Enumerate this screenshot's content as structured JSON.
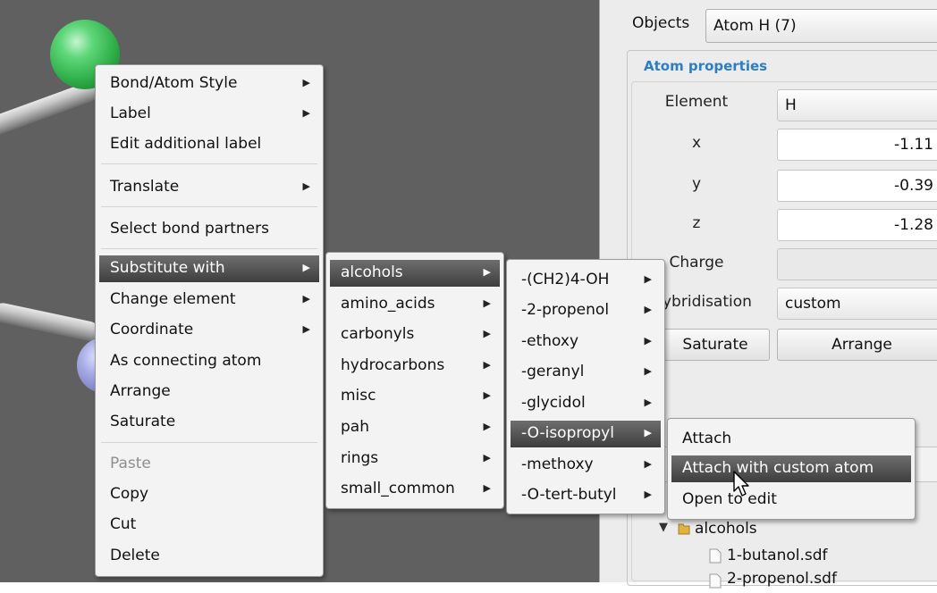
{
  "panel": {
    "objects_label": "Objects",
    "objects_value": "Atom H (7)",
    "section_title": "Atom properties",
    "element_label": "Element",
    "element_value": "H",
    "x_label": "x",
    "x_value": "-1.11",
    "y_label": "y",
    "y_value": "-0.39",
    "z_label": "z",
    "z_value": "-1.28",
    "charge_label": "Charge",
    "hybridisation_label": "ybridisation",
    "hybridisation_value": "custom",
    "saturate_button": "Saturate",
    "arrange_button": "Arrange",
    "tree_folder": "alcohols",
    "tree_file1": "1-butanol.sdf",
    "tree_file2": "2-propenol.sdf"
  },
  "context_menu": {
    "items": [
      "Bond/Atom Style",
      "Label",
      "Edit additional label",
      "Translate",
      "Select bond partners",
      "Substitute with",
      "Change element",
      "Coordinate",
      "As connecting atom",
      "Arrange",
      "Saturate",
      "Paste",
      "Copy",
      "Cut",
      "Delete"
    ]
  },
  "substitute_menu": {
    "items": [
      "alcohols",
      "amino_acids",
      "carbonyls",
      "hydrocarbons",
      "misc",
      "pah",
      "rings",
      "small_common"
    ]
  },
  "alcohols_menu": {
    "items": [
      "-(CH2)4-OH",
      "-2-propenol",
      "-ethoxy",
      "-geranyl",
      "-glycidol",
      "-O-isopropyl",
      "-methoxy",
      "-O-tert-butyl"
    ]
  },
  "action_menu": {
    "items": [
      "Attach",
      "Attach with custom atom",
      "Open to edit"
    ]
  },
  "icons": {
    "submenu_arrow": "▶",
    "tree_expand": "▼"
  },
  "colors": {
    "highlight": "#4a4a4a",
    "section_title": "#2a7fc9",
    "viewport_bg": "#606060",
    "atom_green": "#3fbf5a",
    "atom_blue": "#9aa0d8"
  }
}
